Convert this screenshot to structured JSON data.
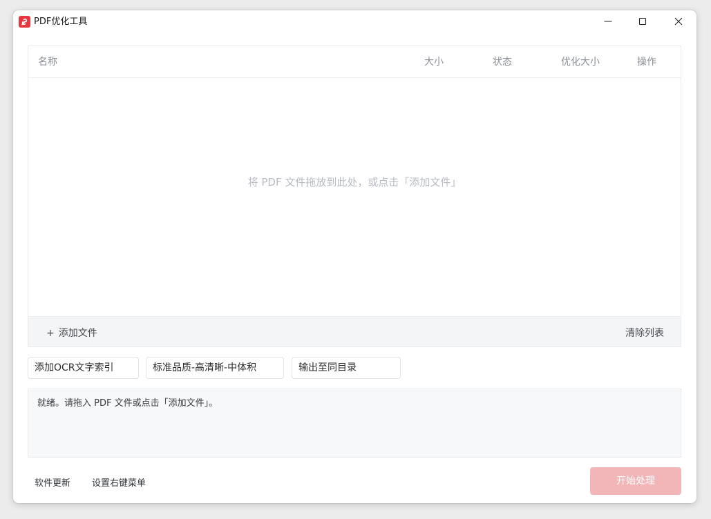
{
  "window": {
    "title": "PDF优化工具",
    "brand_color": "#e8363f"
  },
  "table": {
    "columns": {
      "name": "名称",
      "size": "大小",
      "status": "状态",
      "optimized_size": "优化大小",
      "action": "操作"
    },
    "rows": [],
    "empty_hint": "将 PDF 文件拖放到此处，或点击「添加文件」"
  },
  "file_actions": {
    "add_icon": "+",
    "add_label": "添加文件",
    "clear_label": "清除列表"
  },
  "options": {
    "ocr": "添加OCR文字索引",
    "quality": "标准品质-高清晰-中体积",
    "output": "输出至同目录"
  },
  "log": {
    "text": "就绪。请拖入 PDF 文件或点击「添加文件」。"
  },
  "footer": {
    "update_label": "软件更新",
    "context_menu_label": "设置右键菜单",
    "start_label": "开始处理",
    "start_button_color": "#f2b6b9"
  }
}
